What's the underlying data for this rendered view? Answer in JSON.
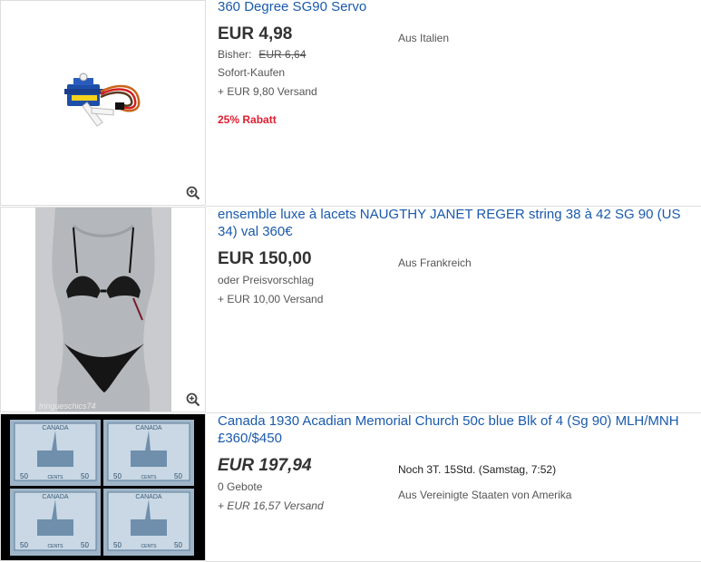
{
  "listings": [
    {
      "title": "360 Degree SG90 Servo",
      "price": "EUR 4,98",
      "was_label": "Bisher:",
      "was_price": "EUR 6,64",
      "format": "Sofort-Kaufen",
      "shipping": "+ EUR 9,80 Versand",
      "discount": "25% Rabatt",
      "location": "Aus Italien"
    },
    {
      "title": "ensemble luxe à lacets NAUGTHY JANET REGER string 38 à 42 SG 90 (US 34) val 360€",
      "price": "EUR 150,00",
      "format": "oder Preisvorschlag",
      "shipping": "+ EUR 10,00 Versand",
      "location": "Aus Frankreich",
      "watermark": "tringueschics74"
    },
    {
      "title": "Canada 1930 Acadian Memorial Church 50c blue Blk of 4 (Sg 90) MLH/MNH £360/$450",
      "price": "EUR 197,94",
      "bids": "0 Gebote",
      "shipping": "+ EUR 16,57 Versand",
      "time_left": "Noch 3T. 15Std. (Samstag, 7:52)",
      "location": "Aus Vereinigte Staaten von Amerika",
      "stamp_country": "CANADA",
      "stamp_value": "50",
      "stamp_cents": "CENTS"
    }
  ],
  "icons": {
    "zoom": "zoom-in-icon"
  },
  "colors": {
    "link": "#1a5aab",
    "discount": "#dd1e31",
    "border": "#dddddd"
  }
}
